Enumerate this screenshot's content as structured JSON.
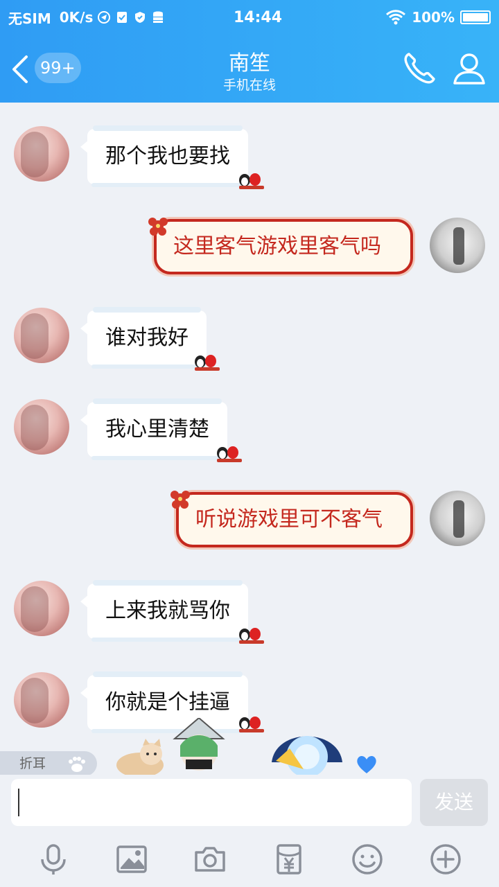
{
  "status_bar": {
    "carrier": "无SIM",
    "speed": "0K/s",
    "time": "14:44",
    "battery": "100%"
  },
  "header": {
    "unread_badge": "99+",
    "title": "南笙",
    "subtitle": "手机在线"
  },
  "messages": [
    {
      "side": "left",
      "text": "那个我也要找"
    },
    {
      "side": "right",
      "text": "这里客气游戏里客气吗"
    },
    {
      "side": "left",
      "text": "谁对我好"
    },
    {
      "side": "left",
      "text": "我心里清楚"
    },
    {
      "side": "right",
      "text": "听说游戏里可不客气"
    },
    {
      "side": "left",
      "text": "上来我就骂你"
    },
    {
      "side": "left",
      "text": "你就是个挂逼"
    }
  ],
  "fold_tab": {
    "label": "折耳"
  },
  "input": {
    "value": "",
    "send_label": "发送"
  },
  "toolbar_icons": [
    "microphone-icon",
    "image-icon",
    "camera-icon",
    "red-packet-icon",
    "emoji-icon",
    "plus-icon"
  ],
  "colors": {
    "header": "#2f9cf4",
    "accent_red": "#c4281e",
    "bubble_white": "#ffffff",
    "background": "#eef1f6"
  }
}
